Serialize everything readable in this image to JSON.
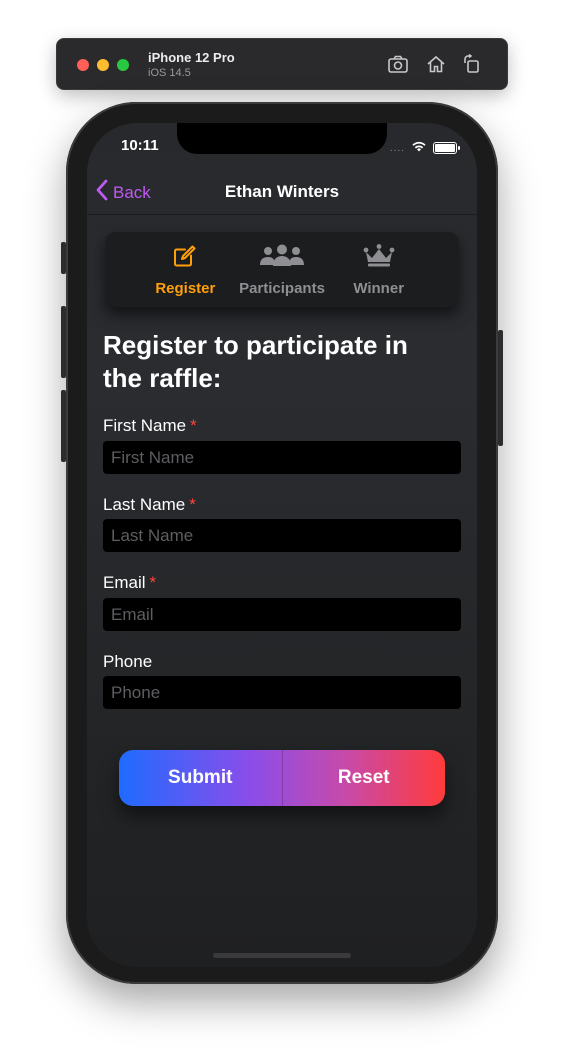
{
  "simulator": {
    "device_name": "iPhone 12 Pro",
    "os_version": "iOS 14.5",
    "tools": [
      "screenshot-icon",
      "home-icon",
      "rotate-icon"
    ]
  },
  "status_bar": {
    "time": "10:11",
    "signal_dots": "....",
    "icons": [
      "wifi-icon",
      "battery-icon"
    ]
  },
  "nav": {
    "back_label": "Back",
    "title": "Ethan Winters"
  },
  "tabs": [
    {
      "label": "Register",
      "icon": "edit-icon",
      "active": true
    },
    {
      "label": "Participants",
      "icon": "people-icon",
      "active": false
    },
    {
      "label": "Winner",
      "icon": "crown-icon",
      "active": false
    }
  ],
  "form": {
    "heading": "Register to participate in the raffle:",
    "required_marker": "*",
    "fields": [
      {
        "label": "First Name",
        "placeholder": "First Name",
        "required": true,
        "value": ""
      },
      {
        "label": "Last Name",
        "placeholder": "Last Name",
        "required": true,
        "value": ""
      },
      {
        "label": "Email",
        "placeholder": "Email",
        "required": true,
        "value": ""
      },
      {
        "label": "Phone",
        "placeholder": "Phone",
        "required": false,
        "value": ""
      }
    ]
  },
  "buttons": {
    "submit_label": "Submit",
    "reset_label": "Reset"
  },
  "colors": {
    "accent_back": "#bf5af2",
    "active_tab": "#ff9f0a",
    "inactive_tab": "#8e8e93",
    "required": "#ff453a",
    "gradient_start": "#1f6bff",
    "gradient_end": "#ff3b3b"
  }
}
